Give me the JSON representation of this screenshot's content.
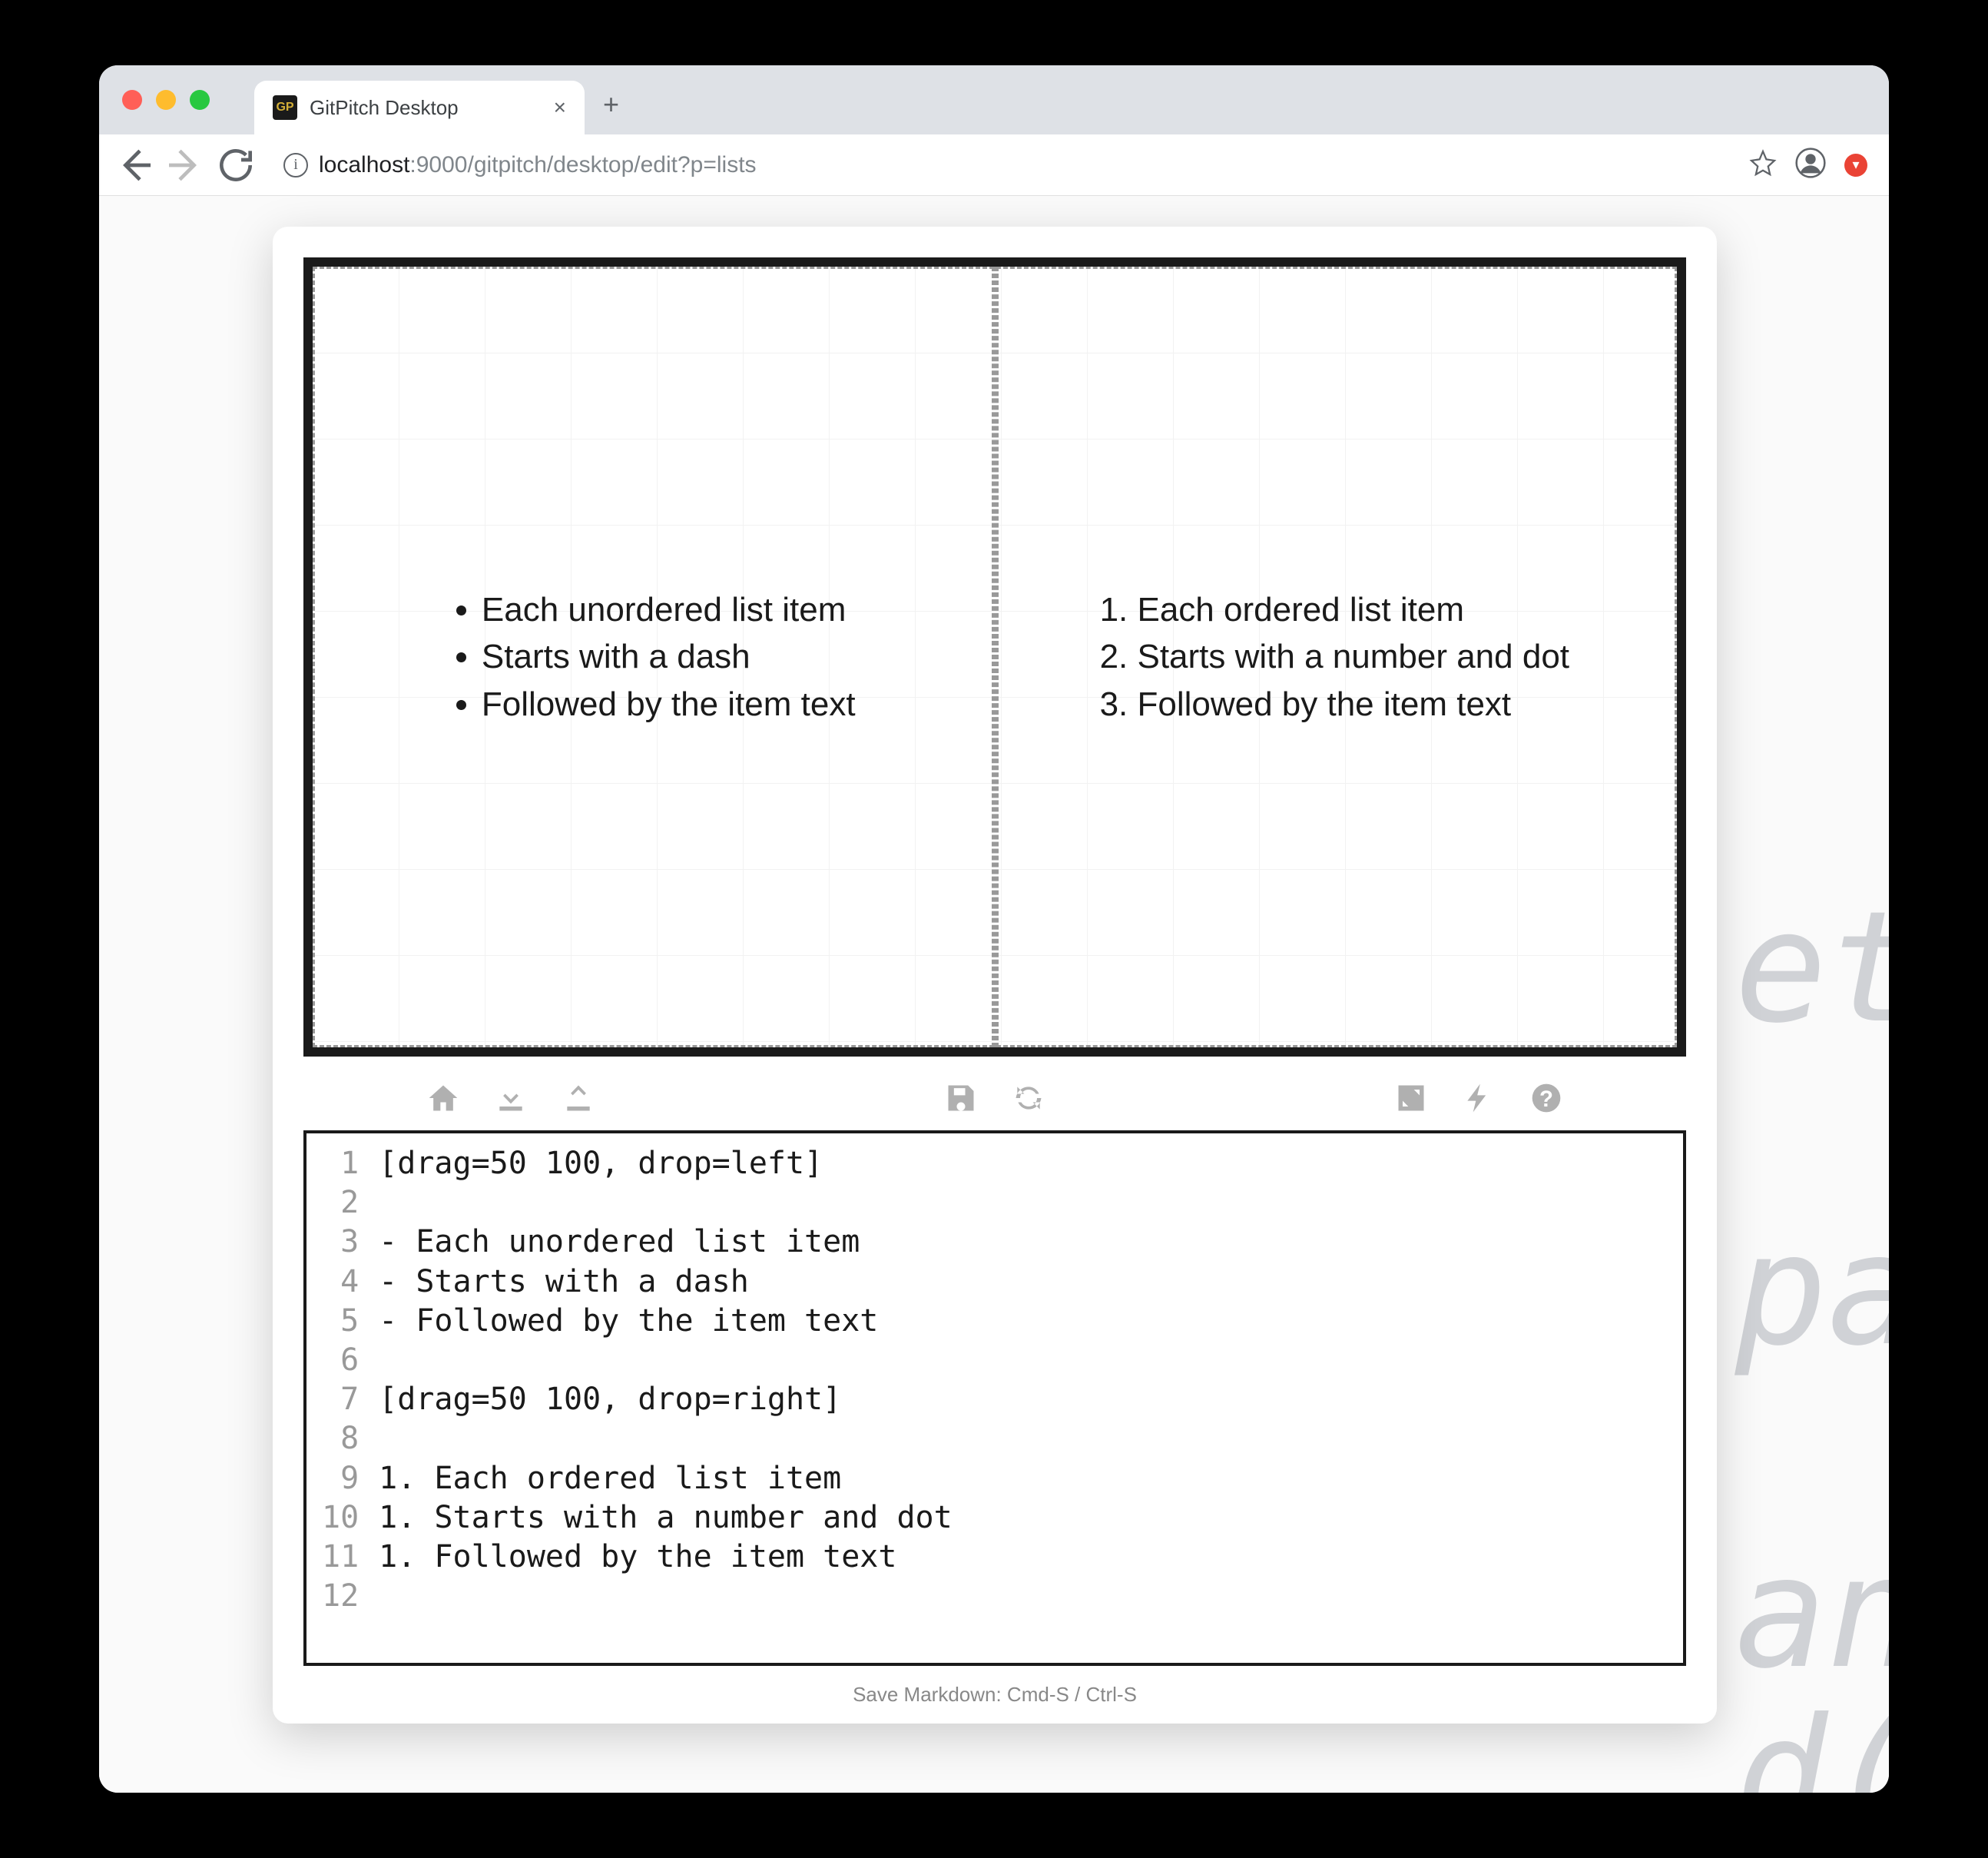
{
  "browser": {
    "tab_title": "GitPitch Desktop",
    "url_host": "localhost",
    "url_port": ":9000",
    "url_path": "/gitpitch/desktop/edit?p=lists"
  },
  "slide": {
    "unordered": [
      "Each unordered list item",
      "Starts with a dash",
      "Followed by the item text"
    ],
    "ordered": [
      "Each ordered list item",
      "Starts with a number and dot",
      "Followed by the item text"
    ]
  },
  "editor_lines": [
    "[drag=50 100, drop=left]",
    "",
    "- Each unordered list item",
    "- Starts with a dash",
    "- Followed by the item text",
    "",
    "[drag=50 100, drop=right]",
    "",
    "1. Each ordered list item",
    "1. Starts with a number and dot",
    "1. Followed by the item text",
    ""
  ],
  "footer_hint": "Save Markdown: Cmd-S / Ctrl-S",
  "bg_text": "et\n\npa\n\nan\nd("
}
